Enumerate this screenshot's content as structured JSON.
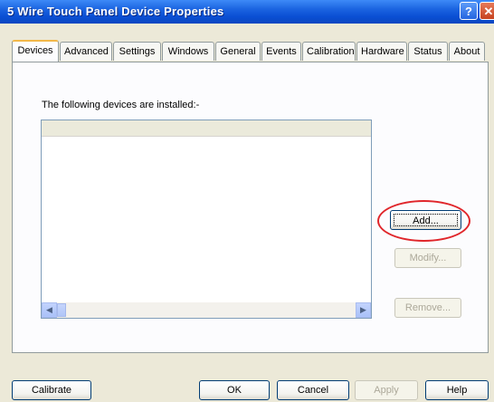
{
  "window": {
    "title": "5 Wire Touch Panel Device Properties"
  },
  "titlebar_icons": {
    "help": "help-icon",
    "close": "close-icon"
  },
  "tabs": [
    {
      "label": "Devices"
    },
    {
      "label": "Advanced"
    },
    {
      "label": "Settings"
    },
    {
      "label": "Windows"
    },
    {
      "label": "General"
    },
    {
      "label": "Events"
    },
    {
      "label": "Calibration"
    },
    {
      "label": "Hardware"
    },
    {
      "label": "Status"
    },
    {
      "label": "About"
    }
  ],
  "devices": {
    "label": "The following devices are installed:-",
    "add_button": "Add...",
    "modify_button": "Modify...",
    "remove_button": "Remove..."
  },
  "footer": {
    "calibrate": "Calibrate",
    "ok": "OK",
    "cancel": "Cancel",
    "apply": "Apply",
    "help": "Help"
  },
  "colors": {
    "accent": "#0a4fd4",
    "highlight_circle": "#e0262b"
  }
}
